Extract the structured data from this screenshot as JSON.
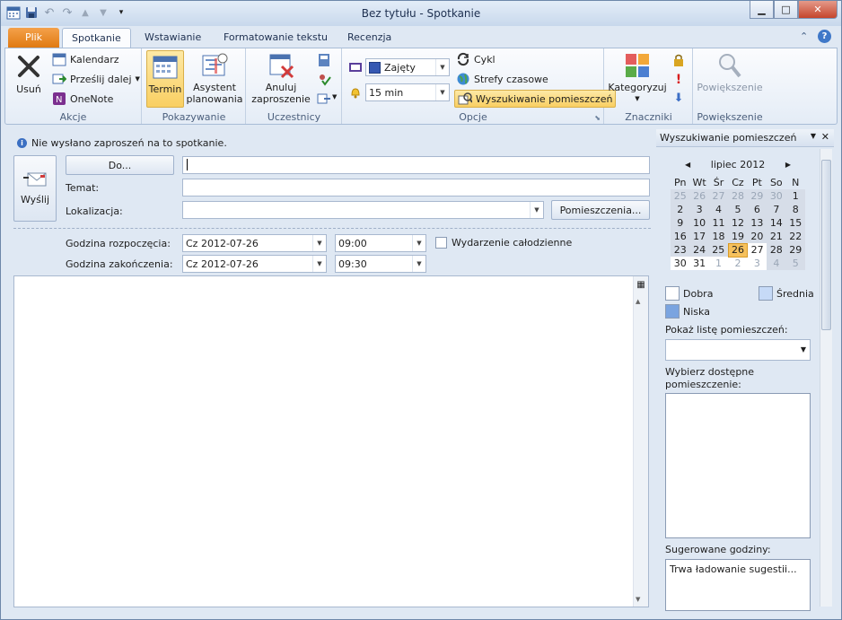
{
  "window": {
    "title": "Bez tytułu  -  Spotkanie",
    "minimize": "▁",
    "maximize": "□",
    "close": "✕"
  },
  "tabs": [
    "Plik",
    "Spotkanie",
    "Wstawianie",
    "Formatowanie tekstu",
    "Recenzja"
  ],
  "ribbon": {
    "akcje": {
      "label": "Akcje",
      "usun": "Usuń",
      "kalendarz": "Kalendarz",
      "przeslij": "Prześlij dalej",
      "onenote": "OneNote"
    },
    "pokazywanie": {
      "label": "Pokazywanie",
      "termin": "Termin",
      "asystent_line1": "Asystent",
      "asystent_line2": "planowania"
    },
    "uczestnicy": {
      "label": "Uczestnicy",
      "anuluj_line1": "Anuluj",
      "anuluj_line2": "zaproszenie"
    },
    "opcje": {
      "label": "Opcje",
      "status": "Zajęty",
      "reminder": "15 min",
      "cykl": "Cykl",
      "strefy": "Strefy czasowe",
      "wyszukiwanie": "Wyszukiwanie pomieszczeń"
    },
    "znaczniki": {
      "label": "Znaczniki",
      "kategoryzuj": "Kategoryzuj"
    },
    "powiekszenie": {
      "label": "Powiększenie",
      "button": "Powiększenie"
    }
  },
  "form": {
    "info": "Nie wysłano zaproszeń na to spotkanie.",
    "wyslij": "Wyślij",
    "do_button": "Do...",
    "temat_label": "Temat:",
    "lokalizacja_label": "Lokalizacja:",
    "pomieszczenia_button": "Pomieszczenia...",
    "start_label": "Godzina rozpoczęcia:",
    "start_date": "Cz 2012-07-26",
    "start_time": "09:00",
    "end_label": "Godzina zakończenia:",
    "end_date": "Cz 2012-07-26",
    "end_time": "09:30",
    "allday_label": "Wydarzenie całodzienne"
  },
  "pane": {
    "title": "Wyszukiwanie pomieszczeń",
    "month": "lipiec 2012",
    "weekdays": [
      "Pn",
      "Wt",
      "Śr",
      "Cz",
      "Pt",
      "So",
      "N"
    ],
    "weeks": [
      [
        "25",
        "26",
        "27",
        "28",
        "29",
        "30",
        "1"
      ],
      [
        "2",
        "3",
        "4",
        "5",
        "6",
        "7",
        "8"
      ],
      [
        "9",
        "10",
        "11",
        "12",
        "13",
        "14",
        "15"
      ],
      [
        "16",
        "17",
        "18",
        "19",
        "20",
        "21",
        "22"
      ],
      [
        "23",
        "24",
        "25",
        "26",
        "27",
        "28",
        "29"
      ],
      [
        "30",
        "31",
        "1",
        "2",
        "3",
        "4",
        "5"
      ]
    ],
    "legend_dobra": "Dobra",
    "legend_srednia": "Średnia",
    "legend_niska": "Niska",
    "colors": {
      "dobra": "#ffffff",
      "srednia": "#c6daf7",
      "niska": "#7aa4e0"
    },
    "pokaz_label": "Pokaż listę pomieszczeń:",
    "wybierz_label": "Wybierz dostępne pomieszczenie:",
    "sugerowane_label": "Sugerowane godziny:",
    "sugerowane_text": "Trwa ładowanie sugestii..."
  }
}
